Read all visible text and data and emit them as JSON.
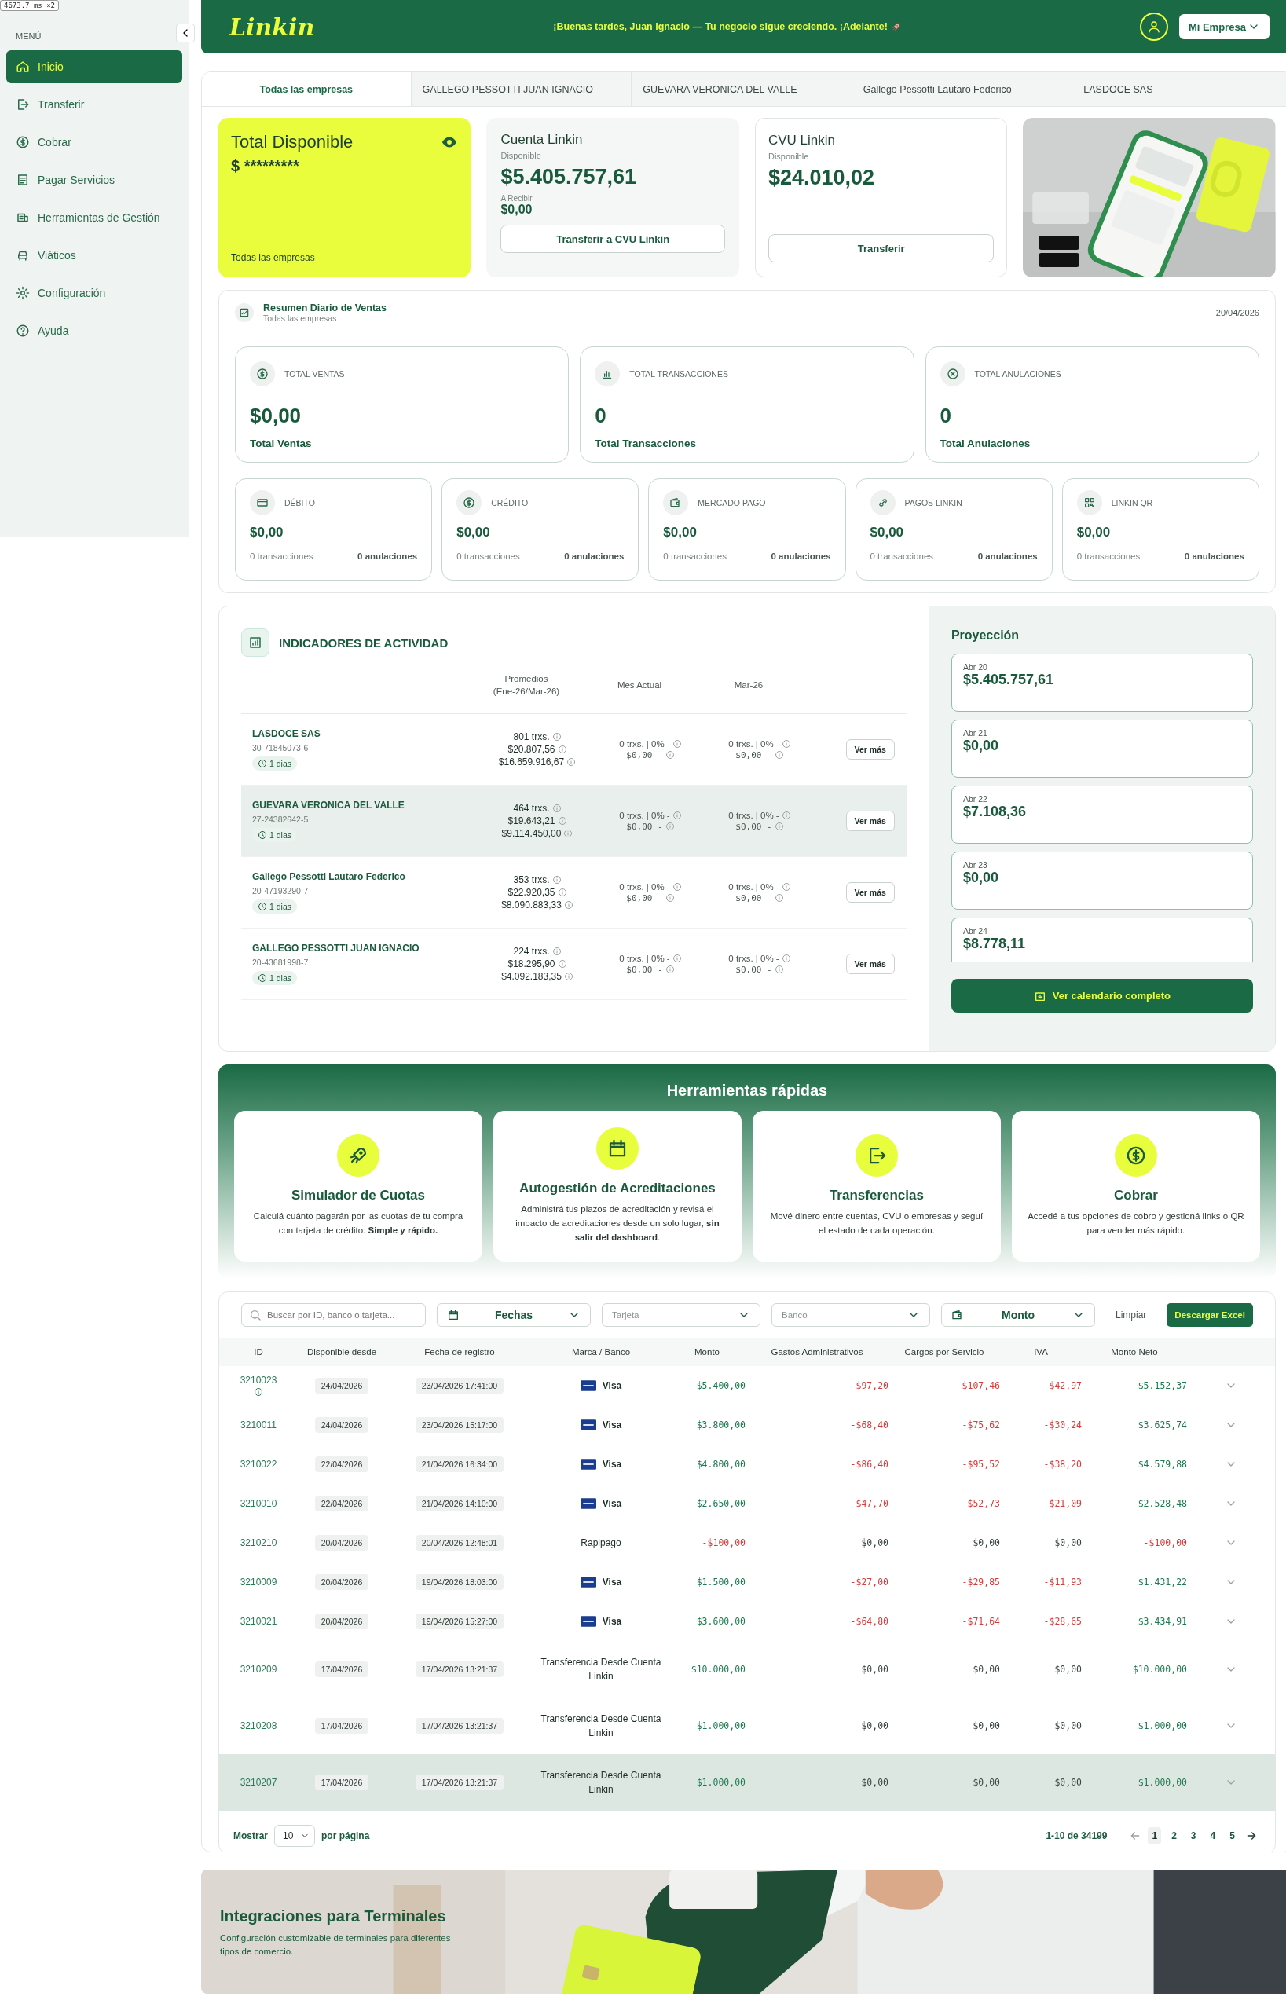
{
  "perf_badge": "4673.7 ms ×2",
  "sidebar": {
    "heading": "MENÚ",
    "items": [
      {
        "label": "Inicio",
        "selected": true
      },
      {
        "label": "Transferir",
        "selected": false
      },
      {
        "label": "Cobrar",
        "selected": false
      },
      {
        "label": "Pagar Servicios",
        "selected": false
      },
      {
        "label": "Herramientas de Gestión",
        "selected": false
      },
      {
        "label": "Viáticos",
        "selected": false
      },
      {
        "label": "Configuración",
        "selected": false
      },
      {
        "label": "Ayuda",
        "selected": false
      }
    ]
  },
  "header": {
    "logo": "Linkin",
    "greeting": "¡Buenas tardes, Juan ignacio — Tu negocio sigue creciendo. ¡Adelante!",
    "menu_button": "Mi Empresa"
  },
  "tabs": [
    {
      "label": "Todas las empresas",
      "selected": true
    },
    {
      "label": "GALLEGO PESSOTTI JUAN IGNACIO",
      "selected": false
    },
    {
      "label": "GUEVARA VERONICA DEL VALLE",
      "selected": false
    },
    {
      "label": "Gallego Pessotti Lautaro Federico",
      "selected": false
    },
    {
      "label": "LASDOCE SAS",
      "selected": false
    }
  ],
  "balances": {
    "total": {
      "title": "Total Disponible",
      "amount": "$ *********",
      "footer": "Todas las empresas"
    },
    "account": {
      "title": "Cuenta Linkin",
      "label": "Disponible",
      "amount": "$5.405.757,61",
      "pending_label": "A Recibir",
      "pending": "$0,00",
      "button": "Transferir a CVU Linkin"
    },
    "cvu": {
      "title": "CVU Linkin",
      "label": "Disponible",
      "amount": "$24.010,02",
      "button": "Transferir"
    }
  },
  "sales_summary": {
    "title": "Resumen Diario de Ventas",
    "subtitle": "Todas las empresas",
    "date": "20/04/2026",
    "totals": [
      {
        "label": "TOTAL VENTAS",
        "value": "$0,00",
        "caption": "Total Ventas"
      },
      {
        "label": "TOTAL TRANSACCIONES",
        "value": "0",
        "caption": "Total Transacciones"
      },
      {
        "label": "TOTAL ANULACIONES",
        "value": "0",
        "caption": "Total Anulaciones"
      }
    ],
    "methods": [
      {
        "label": "DÉBITO",
        "amount": "$0,00",
        "transactions": "0 transacciones",
        "cancellations": "0 anulaciones"
      },
      {
        "label": "CRÉDITO",
        "amount": "$0,00",
        "transactions": "0 transacciones",
        "cancellations": "0 anulaciones"
      },
      {
        "label": "MERCADO PAGO",
        "amount": "$0,00",
        "transactions": "0 transacciones",
        "cancellations": "0 anulaciones"
      },
      {
        "label": "PAGOS LINKIN",
        "amount": "$0,00",
        "transactions": "0 transacciones",
        "cancellations": "0 anulaciones"
      },
      {
        "label": "LINKIN QR",
        "amount": "$0,00",
        "transactions": "0 transacciones",
        "cancellations": "0 anulaciones"
      }
    ]
  },
  "activity": {
    "title": "INDICADORES DE ACTIVIDAD",
    "columns": [
      "Promedios\n(Ene-26/Mar-26)",
      "Mes Actual",
      "Mar-26"
    ],
    "rows": [
      {
        "name": "LASDOCE SAS",
        "tax_id": "30-71845073-6",
        "days": "1 dias",
        "averages": [
          "801 trxs.",
          "$20.807,56",
          "$16.659.916,67"
        ],
        "current": [
          "0 trxs. | 0% -",
          "$0,00 -"
        ],
        "previous": [
          "0 trxs. | 0% -",
          "$0,00 -"
        ],
        "button": "Ver más",
        "highlighted": false
      },
      {
        "name": "GUEVARA VERONICA DEL VALLE",
        "tax_id": "27-24382642-5",
        "days": "1 dias",
        "averages": [
          "464 trxs.",
          "$19.643,21",
          "$9.114.450,00"
        ],
        "current": [
          "0 trxs. | 0% -",
          "$0,00 -"
        ],
        "previous": [
          "0 trxs. | 0% -",
          "$0,00 -"
        ],
        "button": "Ver más",
        "highlighted": true
      },
      {
        "name": "Gallego Pessotti Lautaro Federico",
        "tax_id": "20-47193290-7",
        "days": "1 dias",
        "averages": [
          "353 trxs.",
          "$22.920,35",
          "$8.090.883,33"
        ],
        "current": [
          "0 trxs. | 0% -",
          "$0,00 -"
        ],
        "previous": [
          "0 trxs. | 0% -",
          "$0,00 -"
        ],
        "button": "Ver más",
        "highlighted": false
      },
      {
        "name": "GALLEGO PESSOTTI JUAN IGNACIO",
        "tax_id": "20-43681998-7",
        "days": "1 dias",
        "averages": [
          "224 trxs.",
          "$18.295,90",
          "$4.092.183,35"
        ],
        "current": [
          "0 trxs. | 0% -",
          "$0,00 -"
        ],
        "previous": [
          "0 trxs. | 0% -",
          "$0,00 -"
        ],
        "button": "Ver más",
        "highlighted": false
      }
    ]
  },
  "projection": {
    "title": "Proyección",
    "items": [
      {
        "date": "Abr 20",
        "amount": "$5.405.757,61"
      },
      {
        "date": "Abr 21",
        "amount": "$0,00"
      },
      {
        "date": "Abr 22",
        "amount": "$7.108,36"
      },
      {
        "date": "Abr 23",
        "amount": "$0,00"
      },
      {
        "date": "Abr 24",
        "amount": "$8.778,11"
      }
    ],
    "button": "Ver calendario completo"
  },
  "quick_tools": {
    "title": "Herramientas rápidas",
    "cards": [
      {
        "title": "Simulador de Cuotas",
        "text": "Calculá cuánto pagarán por las cuotas de tu compra con tarjeta de crédito. **Simple y rápido.**"
      },
      {
        "title": "Autogestión de Acreditaciones",
        "text": "Administrá tus plazos de acreditación y revisá el impacto de acreditaciones desde un solo lugar, **sin salir del dashboard**."
      },
      {
        "title": "Transferencias",
        "text": "Mové dinero entre cuentas, CVU o empresas y seguí el estado de cada operación."
      },
      {
        "title": "Cobrar",
        "text": "Accedé a tus opciones de cobro y gestioná links o QR para vender más rápido."
      }
    ]
  },
  "transactions": {
    "search": {
      "placeholder": "Buscar por ID, banco o tarjeta..."
    },
    "filters": [
      {
        "kind": "date",
        "label": "Fechas"
      },
      {
        "kind": "select",
        "placeholder": "Tarjeta"
      },
      {
        "kind": "select",
        "placeholder": "Banco"
      },
      {
        "kind": "amount",
        "label": "Monto"
      }
    ],
    "clear": "Limpiar",
    "export": "Descargar Excel",
    "columns": [
      "ID",
      "Disponible desde",
      "Fecha de registro",
      "Marca / Banco",
      "Monto",
      "Gastos Administrativos",
      "Cargos por Servicio",
      "IVA",
      "Monto Neto"
    ],
    "rows": [
      {
        "id": "3210023",
        "info": true,
        "available": "24/04/2026",
        "registered": "23/04/2026 17:41:00",
        "brand": {
          "kind": "card",
          "name": "Visa"
        },
        "amounts": [
          {
            "text": "$5.400,00",
            "color": "#1d7a4e"
          },
          {
            "text": "-$97,20",
            "color": "#d63b3b"
          },
          {
            "text": "-$107,46",
            "color": "#d63b3b"
          },
          {
            "text": "-$42,97",
            "color": "#d63b3b"
          },
          {
            "text": "$5.152,37",
            "color": "#1d7a4e"
          }
        ],
        "highlighted": false
      },
      {
        "id": "3210011",
        "info": false,
        "available": "24/04/2026",
        "registered": "23/04/2026 15:17:00",
        "brand": {
          "kind": "card",
          "name": "Visa"
        },
        "amounts": [
          {
            "text": "$3.800,00",
            "color": "#1d7a4e"
          },
          {
            "text": "-$68,40",
            "color": "#d63b3b"
          },
          {
            "text": "-$75,62",
            "color": "#d63b3b"
          },
          {
            "text": "-$30,24",
            "color": "#d63b3b"
          },
          {
            "text": "$3.625,74",
            "color": "#1d7a4e"
          }
        ],
        "highlighted": false
      },
      {
        "id": "3210022",
        "info": false,
        "available": "22/04/2026",
        "registered": "21/04/2026 16:34:00",
        "brand": {
          "kind": "card",
          "name": "Visa"
        },
        "amounts": [
          {
            "text": "$4.800,00",
            "color": "#1d7a4e"
          },
          {
            "text": "-$86,40",
            "color": "#d63b3b"
          },
          {
            "text": "-$95,52",
            "color": "#d63b3b"
          },
          {
            "text": "-$38,20",
            "color": "#d63b3b"
          },
          {
            "text": "$4.579,88",
            "color": "#1d7a4e"
          }
        ],
        "highlighted": false
      },
      {
        "id": "3210010",
        "info": false,
        "available": "22/04/2026",
        "registered": "21/04/2026 14:10:00",
        "brand": {
          "kind": "card",
          "name": "Visa"
        },
        "amounts": [
          {
            "text": "$2.650,00",
            "color": "#1d7a4e"
          },
          {
            "text": "-$47,70",
            "color": "#d63b3b"
          },
          {
            "text": "-$52,73",
            "color": "#d63b3b"
          },
          {
            "text": "-$21,09",
            "color": "#d63b3b"
          },
          {
            "text": "$2.528,48",
            "color": "#1d7a4e"
          }
        ],
        "highlighted": false
      },
      {
        "id": "3210210",
        "info": false,
        "available": "20/04/2026",
        "registered": "20/04/2026 12:48:01",
        "brand": {
          "kind": "plain",
          "name": "Rapipago"
        },
        "amounts": [
          {
            "text": "-$100,00",
            "color": "#d63b3b"
          },
          {
            "text": "$0,00",
            "color": "#3a4540"
          },
          {
            "text": "$0,00",
            "color": "#3a4540"
          },
          {
            "text": "$0,00",
            "color": "#3a4540"
          },
          {
            "text": "-$100,00",
            "color": "#d63b3b"
          }
        ],
        "highlighted": false
      },
      {
        "id": "3210009",
        "info": false,
        "available": "20/04/2026",
        "registered": "19/04/2026 18:03:00",
        "brand": {
          "kind": "card",
          "name": "Visa"
        },
        "amounts": [
          {
            "text": "$1.500,00",
            "color": "#1d7a4e"
          },
          {
            "text": "-$27,00",
            "color": "#d63b3b"
          },
          {
            "text": "-$29,85",
            "color": "#d63b3b"
          },
          {
            "text": "-$11,93",
            "color": "#d63b3b"
          },
          {
            "text": "$1.431,22",
            "color": "#1d7a4e"
          }
        ],
        "highlighted": false
      },
      {
        "id": "3210021",
        "info": false,
        "available": "20/04/2026",
        "registered": "19/04/2026 15:27:00",
        "brand": {
          "kind": "card",
          "name": "Visa"
        },
        "amounts": [
          {
            "text": "$3.600,00",
            "color": "#1d7a4e"
          },
          {
            "text": "-$64,80",
            "color": "#d63b3b"
          },
          {
            "text": "-$71,64",
            "color": "#d63b3b"
          },
          {
            "text": "-$28,65",
            "color": "#d63b3b"
          },
          {
            "text": "$3.434,91",
            "color": "#1d7a4e"
          }
        ],
        "highlighted": false
      },
      {
        "id": "3210209",
        "info": false,
        "available": "17/04/2026",
        "registered": "17/04/2026 13:21:37",
        "brand": {
          "kind": "plain",
          "name": "Transferencia Desde Cuenta Linkin"
        },
        "amounts": [
          {
            "text": "$10.000,00",
            "color": "#1d7a4e"
          },
          {
            "text": "$0,00",
            "color": "#3a4540"
          },
          {
            "text": "$0,00",
            "color": "#3a4540"
          },
          {
            "text": "$0,00",
            "color": "#3a4540"
          },
          {
            "text": "$10.000,00",
            "color": "#1d7a4e"
          }
        ],
        "highlighted": false
      },
      {
        "id": "3210208",
        "info": false,
        "available": "17/04/2026",
        "registered": "17/04/2026 13:21:37",
        "brand": {
          "kind": "plain",
          "name": "Transferencia Desde Cuenta Linkin"
        },
        "amounts": [
          {
            "text": "$1.000,00",
            "color": "#1d7a4e"
          },
          {
            "text": "$0,00",
            "color": "#3a4540"
          },
          {
            "text": "$0,00",
            "color": "#3a4540"
          },
          {
            "text": "$0,00",
            "color": "#3a4540"
          },
          {
            "text": "$1.000,00",
            "color": "#1d7a4e"
          }
        ],
        "highlighted": false
      },
      {
        "id": "3210207",
        "info": false,
        "available": "17/04/2026",
        "registered": "17/04/2026 13:21:37",
        "brand": {
          "kind": "plain",
          "name": "Transferencia Desde Cuenta Linkin"
        },
        "amounts": [
          {
            "text": "$1.000,00",
            "color": "#1d7a4e"
          },
          {
            "text": "$0,00",
            "color": "#3a4540"
          },
          {
            "text": "$0,00",
            "color": "#3a4540"
          },
          {
            "text": "$0,00",
            "color": "#3a4540"
          },
          {
            "text": "$1.000,00",
            "color": "#1d7a4e"
          }
        ],
        "highlighted": true
      }
    ],
    "footer": {
      "show": "Mostrar",
      "page_size": "10",
      "per_page": "por página",
      "range": "1-10 de 34199",
      "pages": [
        {
          "label": "1",
          "selected": true
        },
        {
          "label": "2",
          "selected": false
        },
        {
          "label": "3",
          "selected": false
        },
        {
          "label": "4",
          "selected": false
        },
        {
          "label": "5",
          "selected": false
        }
      ]
    }
  },
  "banner": {
    "title": "Integraciones para Terminales",
    "text": "Configuración customizable de terminales para diferentes tipos de comercio."
  }
}
